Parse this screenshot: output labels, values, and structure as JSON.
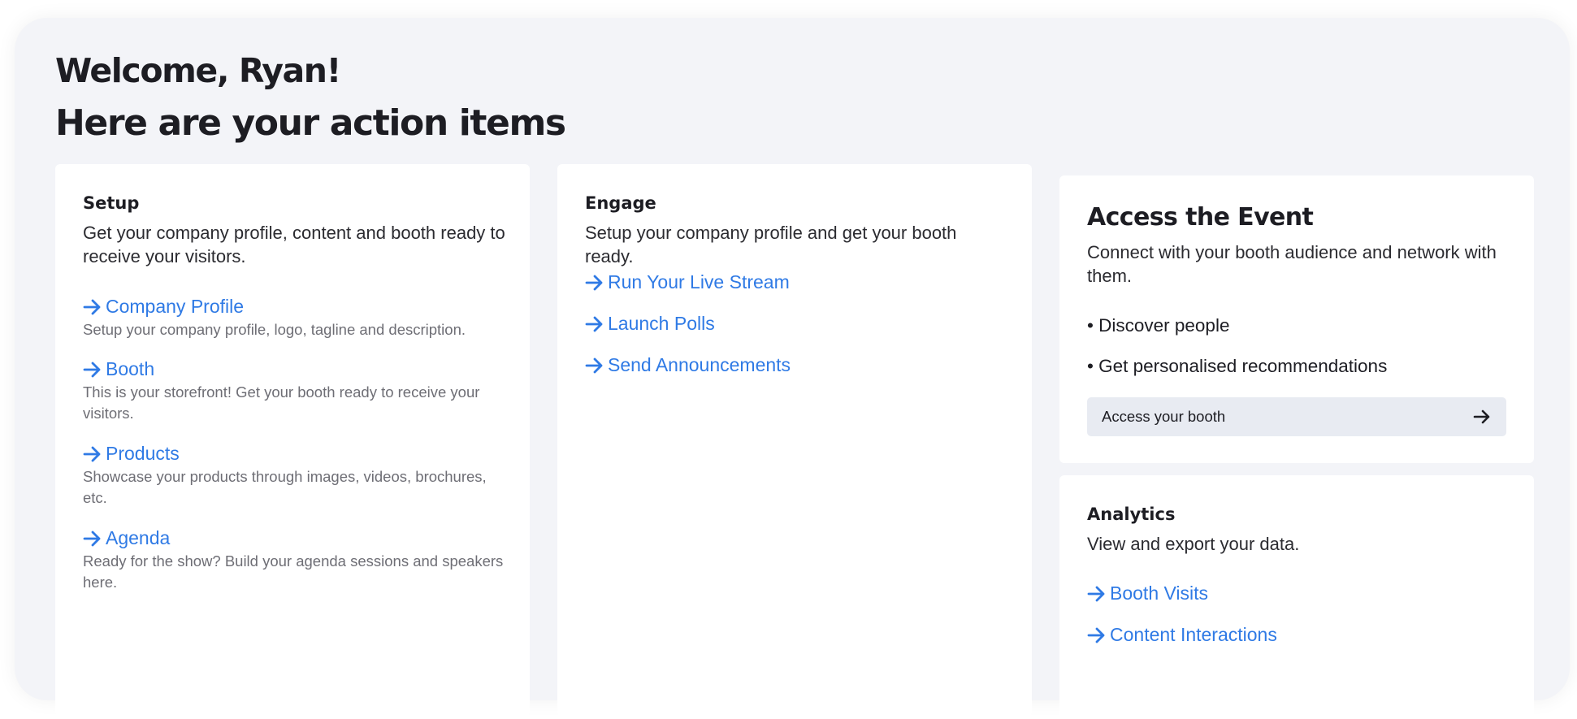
{
  "header": {
    "welcome": "Welcome, Ryan!",
    "subtitle": "Here are your action items"
  },
  "setup": {
    "title": "Setup",
    "description": "Get your company profile, content and booth ready to receive your visitors.",
    "items": [
      {
        "label": "Company Profile",
        "description": "Setup your company profile, logo, tagline and description."
      },
      {
        "label": "Booth",
        "description": "This is your storefront! Get your booth ready to receive your visitors."
      },
      {
        "label": "Products",
        "description": "Showcase your products through images, videos, brochures, etc."
      },
      {
        "label": "Agenda",
        "description": "Ready for the show? Build your agenda sessions and speakers here."
      }
    ]
  },
  "engage": {
    "title": "Engage",
    "description": "Setup your company profile and get your booth ready.",
    "items": [
      {
        "label": "Run Your Live Stream"
      },
      {
        "label": "Launch Polls"
      },
      {
        "label": "Send Announcements"
      }
    ]
  },
  "access": {
    "title": "Access the Event",
    "description": "Connect with your booth audience and network with them.",
    "bullets": [
      "• Discover people",
      "• Get personalised recommendations"
    ],
    "button_label": "Access your booth"
  },
  "analytics": {
    "title": "Analytics",
    "description": "View and export your data.",
    "items": [
      {
        "label": "Booth Visits"
      },
      {
        "label": "Content Interactions"
      }
    ]
  },
  "icons": {
    "link_arrow": "arrow-right-icon",
    "button_arrow": "arrow-right-icon"
  },
  "colors": {
    "link": "#2f7ae5",
    "background": "#f3f4f8",
    "card": "#ffffff",
    "button": "#e8ebf2"
  }
}
